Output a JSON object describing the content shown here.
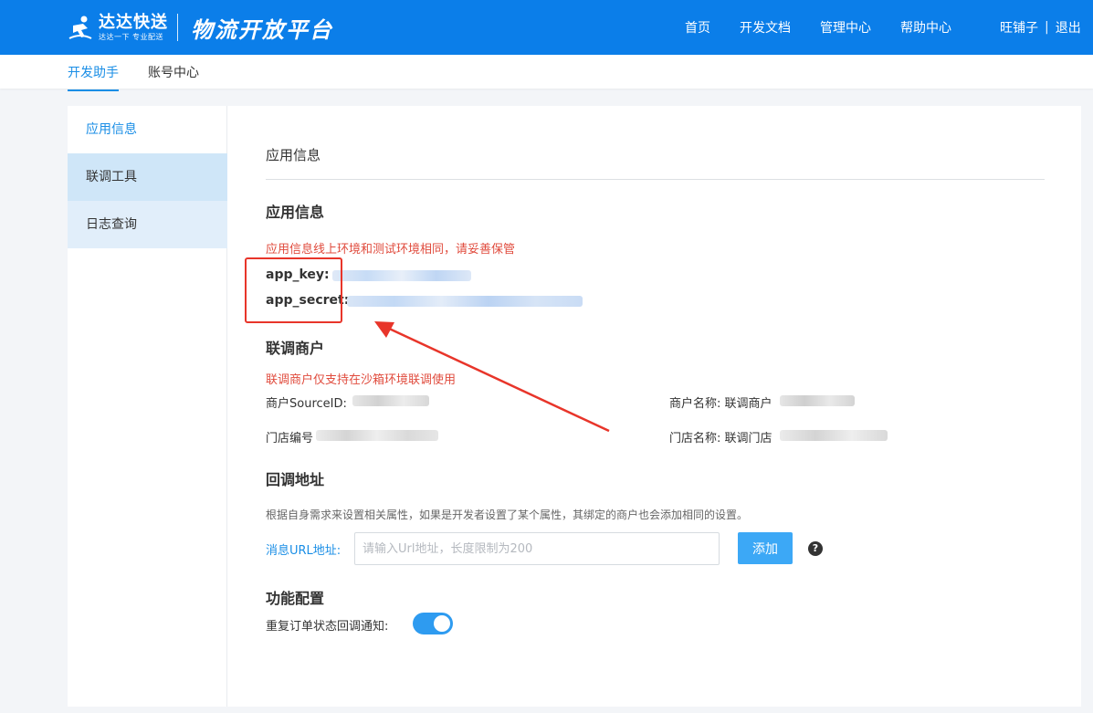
{
  "header": {
    "brand_name": "达达快送",
    "brand_slogan": "达达一下 专业配送",
    "platform_title": "物流开放平台",
    "nav": [
      "首页",
      "开发文档",
      "管理中心",
      "帮助中心"
    ],
    "user_name": "旺铺子",
    "separator": "|",
    "logout": "退出",
    "colors": {
      "bar": "#0b7ee9"
    }
  },
  "subnav": {
    "items": [
      "开发助手",
      "账号中心"
    ],
    "active": "开发助手"
  },
  "sidebar": {
    "items": [
      {
        "label": "应用信息",
        "state": "active"
      },
      {
        "label": "联调工具",
        "state": "highlight"
      },
      {
        "label": "日志查询",
        "state": "highlight-light"
      }
    ]
  },
  "main": {
    "section_title": "应用信息",
    "app_info": {
      "heading": "应用信息",
      "note": "应用信息线上环境和测试环境相同，请妥善保管",
      "app_key_label": "app_key:",
      "app_secret_label": "app_secret:"
    },
    "test_merchant": {
      "heading": "联调商户",
      "note": "联调商户仅支持在沙箱环境联调使用",
      "source_id_label": "商户SourceID:",
      "merchant_name_label": "商户名称: 联调商户",
      "shop_no_label": "门店编号",
      "shop_name_label": "门店名称: 联调门店"
    },
    "callback": {
      "heading": "回调地址",
      "hint": "根据自身需求来设置相关属性，如果是开发者设置了某个属性，其绑定的商户也会添加相同的设置。",
      "url_label": "消息URL地址:",
      "url_placeholder": "请输入Url地址，长度限制为200",
      "url_value": "",
      "add_button": "添加",
      "help_glyph": "?"
    },
    "features": {
      "heading": "功能配置",
      "repeat_notify_label": "重复订单状态回调通知:",
      "repeat_notify_enabled": true
    }
  },
  "colors": {
    "accent": "#1a8ee6",
    "warning_text": "#e04b3d",
    "button": "#3ca8f6",
    "annotation": "#e8352a"
  }
}
